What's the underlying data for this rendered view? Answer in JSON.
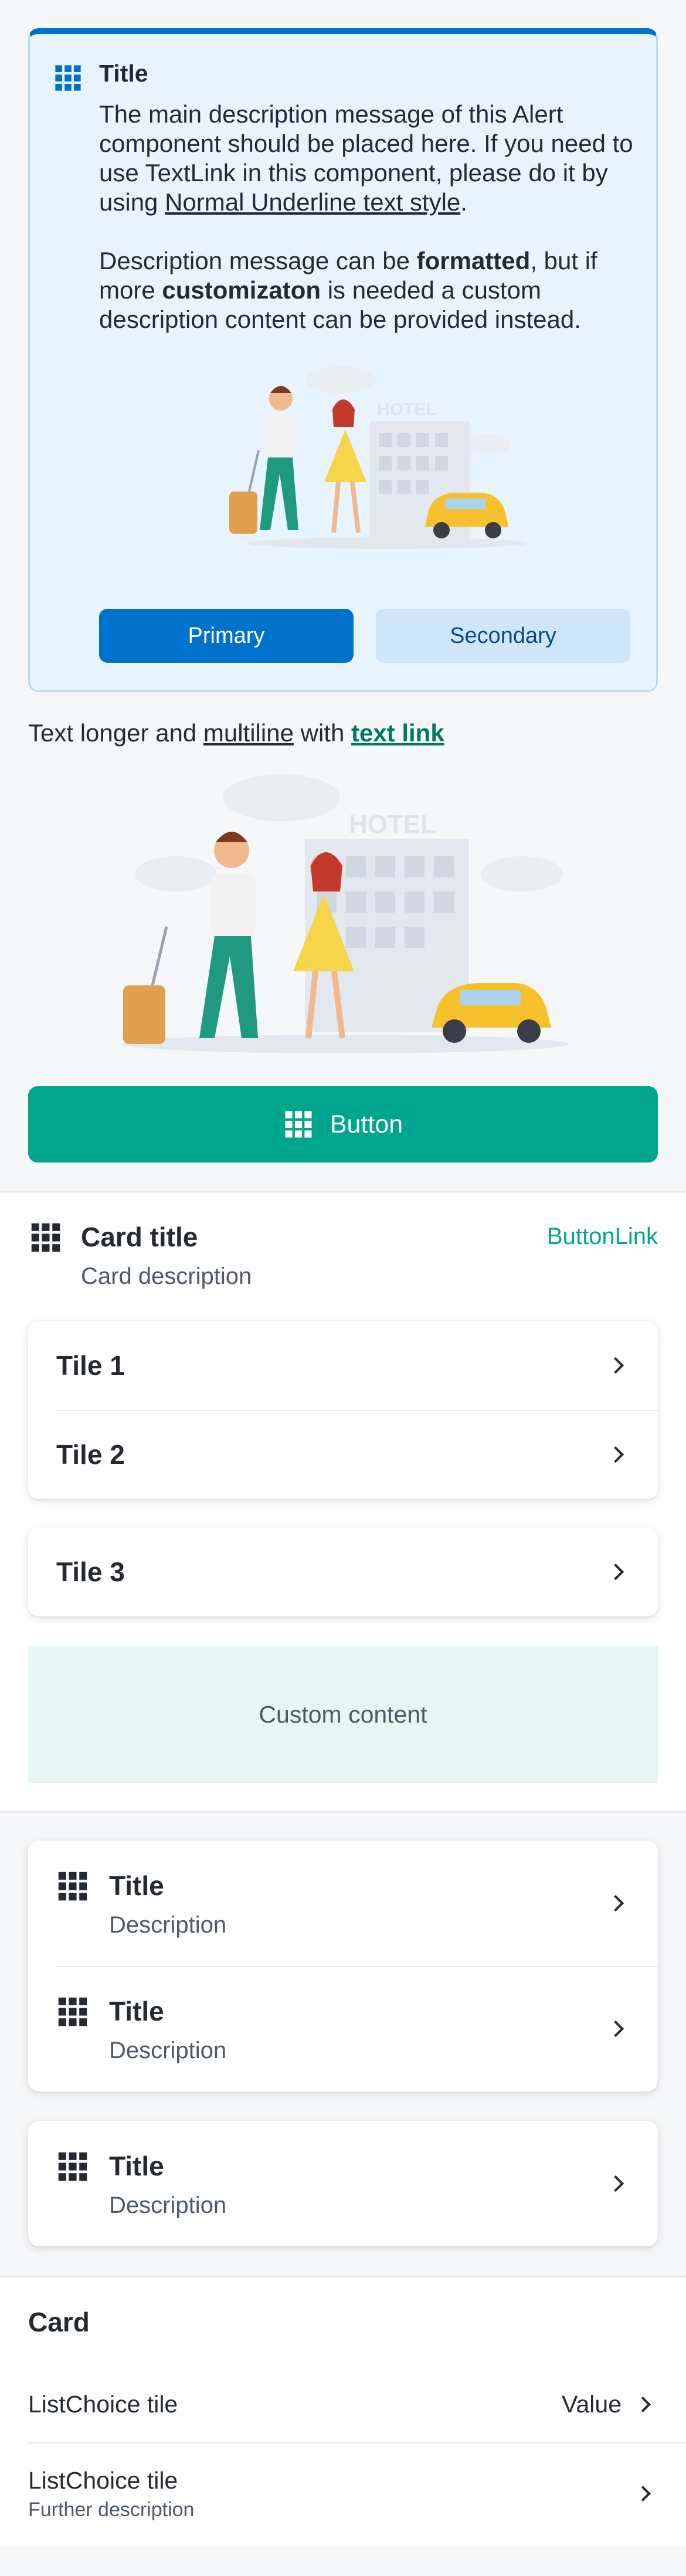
{
  "alert": {
    "title": "Title",
    "desc1_a": "The main description message of this Alert component should be placed here. If you need to use TextLink in this component, please do it by using ",
    "desc1_link": "Normal Underline text style",
    "desc1_end": ".",
    "desc2_a": "Description message can be ",
    "desc2_bold1": "formatted",
    "desc2_b": ", but if more ",
    "desc2_bold2": "customizaton",
    "desc2_c": " is needed a custom description content can be provided instead.",
    "illustration_sign": "HOTEL",
    "primary_label": "Primary",
    "secondary_label": "Secondary"
  },
  "text_line": {
    "part1": "Text longer and ",
    "underlined": "multiline",
    "part2": " with ",
    "link": "text link"
  },
  "illustration_sign": "HOTEL",
  "main_button": {
    "label": "Button",
    "icon": "grid-icon"
  },
  "card": {
    "title": "Card title",
    "description": "Card description",
    "button_link": "ButtonLink",
    "tiles_group": [
      {
        "label": "Tile 1"
      },
      {
        "label": "Tile 2"
      }
    ],
    "tile_single": {
      "label": "Tile 3"
    },
    "custom_content": "Custom content"
  },
  "list_tiles": {
    "group": [
      {
        "title": "Title",
        "description": "Description"
      },
      {
        "title": "Title",
        "description": "Description"
      }
    ],
    "single": {
      "title": "Title",
      "description": "Description"
    }
  },
  "card2": {
    "title": "Card",
    "rows": [
      {
        "label": "ListChoice tile",
        "value": "Value"
      },
      {
        "label": "ListChoice tile",
        "description": "Further description"
      }
    ]
  },
  "colors": {
    "alert_blue": "#0172cb",
    "green_primary": "#00a58e",
    "link_green": "#007a5e",
    "custom_bg": "#e6f6f3"
  }
}
